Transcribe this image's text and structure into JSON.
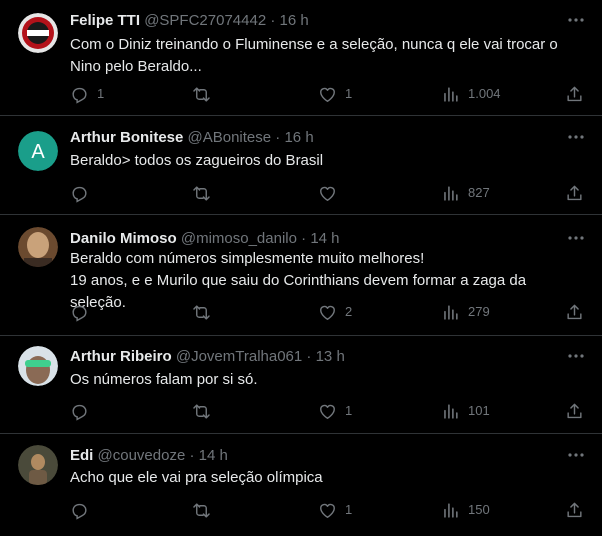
{
  "tweets": [
    {
      "name": "Felipe TTI",
      "handle": "@SPFC27074442",
      "time": "16 h",
      "text": "Com o Diniz treinando o Fluminense e a seleção, nunca q ele vai trocar o\nNino pelo Beraldo...",
      "replies": "1",
      "retweets": "",
      "likes": "1",
      "views": "1.004",
      "avatar_colors": [
        "#e6e6e6",
        "#b3121a"
      ]
    },
    {
      "name": "Arthur Bonitese",
      "handle": "@ABonitese",
      "time": "16 h",
      "text": "Beraldo> todos os zagueiros do Brasil",
      "replies": "",
      "retweets": "",
      "likes": "",
      "views": "827",
      "avatar_letter": "A",
      "avatar_colors": [
        "#1a9e8a",
        "#ffffff"
      ]
    },
    {
      "name": "Danilo Mimoso",
      "handle": "@mimoso_danilo",
      "time": "14 h",
      "text": "Beraldo com números simplesmente muito melhores!\n19 anos, e e Murilo que saiu do Corinthians devem formar a zaga da seleção.",
      "replies": "",
      "retweets": "",
      "likes": "2",
      "views": "279",
      "avatar_colors": [
        "#6b4a2f",
        "#c9a27a"
      ]
    },
    {
      "name": "Arthur Ribeiro",
      "handle": "@JovemTralha061",
      "time": "13 h",
      "text": "Os números falam por si só.",
      "replies": "",
      "retweets": "",
      "likes": "1",
      "views": "101",
      "avatar_colors": [
        "#d9e2e8",
        "#3fcf8e"
      ]
    },
    {
      "name": "Edi",
      "handle": "@couvedoze",
      "time": "14 h",
      "text": "Acho que ele vai pra seleção olímpica",
      "replies": "",
      "retweets": "",
      "likes": "1",
      "views": "150",
      "avatar_colors": [
        "#4a4a3a",
        "#b08a60"
      ]
    }
  ],
  "icons": {
    "reply": "reply-icon",
    "retweet": "retweet-icon",
    "like": "like-icon",
    "views": "views-icon",
    "share": "share-icon",
    "more": "more-icon"
  },
  "colors": {
    "background": "#000000",
    "text": "#e7e9ea",
    "muted": "#71767b",
    "divider": "#2f3336"
  }
}
